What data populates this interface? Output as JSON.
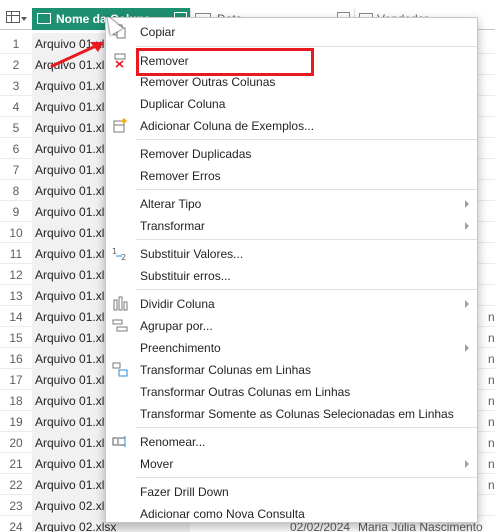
{
  "grid": {
    "headers": {
      "col1": "Nome da Coluna",
      "col2": "Data",
      "col3": "Vendedor"
    },
    "rows": [
      {
        "n": "1",
        "name": "Arquivo 01.xlsx"
      },
      {
        "n": "2",
        "name": "Arquivo 01.xlsx"
      },
      {
        "n": "3",
        "name": "Arquivo 01.xlsx"
      },
      {
        "n": "4",
        "name": "Arquivo 01.xlsx"
      },
      {
        "n": "5",
        "name": "Arquivo 01.xlsx"
      },
      {
        "n": "6",
        "name": "Arquivo 01.xlsx"
      },
      {
        "n": "7",
        "name": "Arquivo 01.xlsx"
      },
      {
        "n": "8",
        "name": "Arquivo 01.xlsx"
      },
      {
        "n": "9",
        "name": "Arquivo 01.xlsx"
      },
      {
        "n": "10",
        "name": "Arquivo 01.xlsx"
      },
      {
        "n": "11",
        "name": "Arquivo 01.xlsx"
      },
      {
        "n": "12",
        "name": "Arquivo 01.xlsx"
      },
      {
        "n": "13",
        "name": "Arquivo 01.xlsx"
      },
      {
        "n": "14",
        "name": "Arquivo 01.xlsx"
      },
      {
        "n": "15",
        "name": "Arquivo 01.xlsx"
      },
      {
        "n": "16",
        "name": "Arquivo 01.xlsx"
      },
      {
        "n": "17",
        "name": "Arquivo 01.xlsx"
      },
      {
        "n": "18",
        "name": "Arquivo 01.xlsx"
      },
      {
        "n": "19",
        "name": "Arquivo 01.xlsx"
      },
      {
        "n": "20",
        "name": "Arquivo 01.xlsx"
      },
      {
        "n": "21",
        "name": "Arquivo 01.xlsx"
      },
      {
        "n": "22",
        "name": "Arquivo 01.xlsx"
      },
      {
        "n": "23",
        "name": "Arquivo 02.xlsx"
      },
      {
        "n": "24",
        "name": "Arquivo 02.xlsx",
        "date": "02/02/2024",
        "seller": "Maria Júlia Nascimento"
      }
    ],
    "right_partial": "n"
  },
  "menu": {
    "items": [
      {
        "label": "Copiar",
        "icon": "copy-icon"
      },
      {
        "label": "Remover",
        "icon": "remove-column-icon"
      },
      {
        "label": "Remover Outras Colunas"
      },
      {
        "label": "Duplicar Coluna"
      },
      {
        "label": "Adicionar Coluna de Exemplos...",
        "icon": "column-from-examples-icon"
      },
      {
        "label": "Remover Duplicadas"
      },
      {
        "label": "Remover Erros"
      },
      {
        "label": "Alterar Tipo",
        "submenu": true
      },
      {
        "label": "Transformar",
        "submenu": true
      },
      {
        "label": "Substituir Valores...",
        "icon": "replace-values-icon"
      },
      {
        "label": "Substituir erros..."
      },
      {
        "label": "Dividir Coluna",
        "icon": "split-column-icon",
        "submenu": true
      },
      {
        "label": "Agrupar por...",
        "icon": "group-by-icon"
      },
      {
        "label": "Preenchimento",
        "submenu": true
      },
      {
        "label": "Transformar Colunas em Linhas",
        "icon": "unpivot-icon"
      },
      {
        "label": "Transformar Outras Colunas em Linhas"
      },
      {
        "label": "Transformar Somente as Colunas Selecionadas em Linhas"
      },
      {
        "label": "Renomear...",
        "icon": "rename-icon"
      },
      {
        "label": "Mover",
        "submenu": true
      },
      {
        "label": "Fazer Drill Down"
      },
      {
        "label": "Adicionar como Nova Consulta"
      }
    ]
  },
  "colors": {
    "header_accent": "#1e8f70",
    "highlight_box": "#e8191f",
    "arrow": "#e8191f"
  }
}
